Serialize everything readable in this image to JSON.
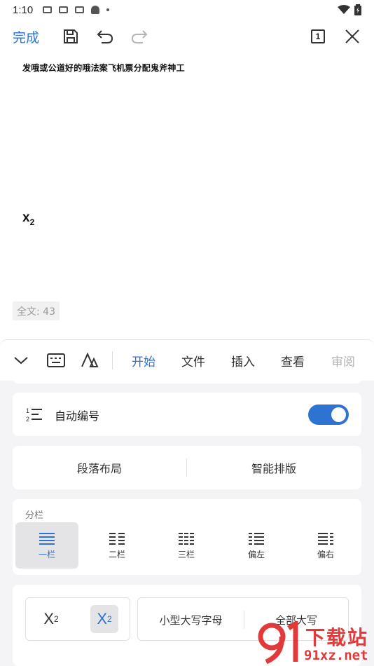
{
  "status_bar": {
    "time": "1:10"
  },
  "toolbar": {
    "done_label": "完成",
    "page_count": "1"
  },
  "document": {
    "line1": "发哦或公道好的哦法案飞机票分配鬼斧神工",
    "line2_base": "x",
    "line2_sub": "2",
    "word_count": "全文: 43"
  },
  "tabs": [
    {
      "label": "开始",
      "active": true
    },
    {
      "label": "文件"
    },
    {
      "label": "插入"
    },
    {
      "label": "查看"
    },
    {
      "label": "审阅"
    }
  ],
  "auto_numbering": {
    "label": "自动编号",
    "enabled": true
  },
  "paragraph": {
    "layout_label": "段落布局",
    "smart_label": "智能排版"
  },
  "columns": {
    "title": "分栏",
    "options": [
      {
        "label": "一栏",
        "selected": true
      },
      {
        "label": "二栏"
      },
      {
        "label": "三栏"
      },
      {
        "label": "偏左"
      },
      {
        "label": "偏右"
      }
    ]
  },
  "script": {
    "superscript_base": "X",
    "superscript_mark": "2",
    "subscript_base": "X",
    "subscript_mark": "2",
    "small_caps_label": "小型大写字母",
    "all_caps_label": "全部大写"
  },
  "watermark": {
    "text": "下载站",
    "url": "91xz.net"
  },
  "colors": {
    "accent": "#2e72d2",
    "watermark": "#e23a3a"
  }
}
